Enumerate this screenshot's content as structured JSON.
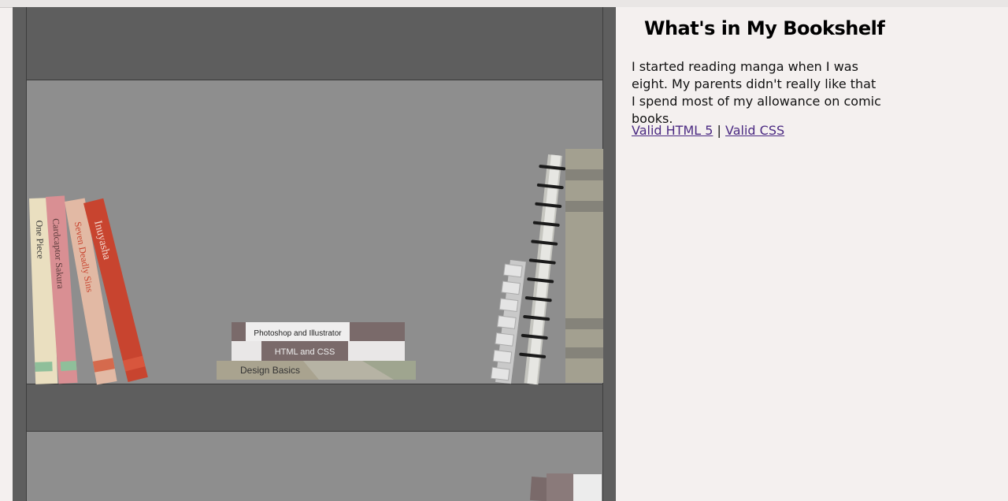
{
  "page": {
    "title": "What's in My Bookshelf",
    "intro": "I started reading manga when I was eight. My parents didn't really like that I spend most of my allowance on comic books.",
    "links": {
      "html": "Valid HTML 5",
      "separator": "|",
      "css": "Valid CSS"
    }
  },
  "books": {
    "spines": [
      {
        "title": "One Piece",
        "color": "#eadfc0"
      },
      {
        "title": "Cardcaptor Sakura",
        "color": "#d98f93"
      },
      {
        "title": "Seven Deadly Sins",
        "color": "#e2b9a4"
      },
      {
        "title": "Inuyasha",
        "color": "#c8442f"
      }
    ],
    "stack": [
      {
        "title": "Photoshop and Illustrator"
      },
      {
        "title": "HTML and CSS"
      },
      {
        "title": "Design Basics"
      }
    ]
  },
  "colors": {
    "shelf_frame": "#5e5e5e",
    "shelf_back": "#8e8e8e",
    "link": "#4b2a82"
  }
}
